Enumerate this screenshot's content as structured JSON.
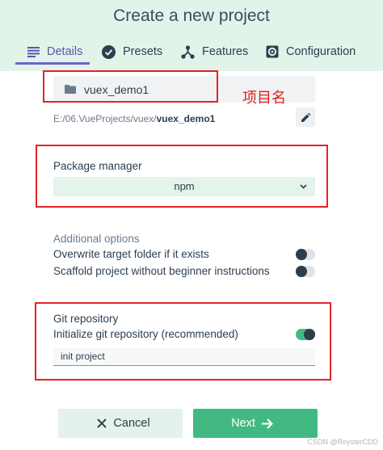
{
  "header": {
    "title": "Create a new project",
    "tabs": [
      {
        "label": "Details",
        "icon": "list-icon",
        "active": true
      },
      {
        "label": "Presets",
        "icon": "check-circle-icon",
        "active": false
      },
      {
        "label": "Features",
        "icon": "nodes-icon",
        "active": false
      },
      {
        "label": "Configuration",
        "icon": "gear-icon",
        "active": false
      }
    ]
  },
  "details": {
    "project_name": "vuex_demo1",
    "path_prefix": "E:/06.VueProjects/vuex/",
    "path_name": "vuex_demo1",
    "annotation": "项目名"
  },
  "package_manager": {
    "label": "Package manager",
    "selected": "npm"
  },
  "additional_options": {
    "label": "Additional options",
    "items": [
      {
        "label": "Overwrite target folder if it exists",
        "enabled": false
      },
      {
        "label": "Scaffold project without beginner instructions",
        "enabled": false
      }
    ]
  },
  "git": {
    "label": "Git repository",
    "init_label": "Initialize git repository (recommended)",
    "init_enabled": true,
    "commit_message": "init project"
  },
  "footer": {
    "cancel_label": "Cancel",
    "next_label": "Next"
  },
  "watermark": "CSDN @RoysterCDD",
  "colors": {
    "accent_green": "#42b983",
    "header_bg": "#e2f3ea",
    "tab_active": "#6c63c8",
    "annotation_red": "#e52227"
  }
}
